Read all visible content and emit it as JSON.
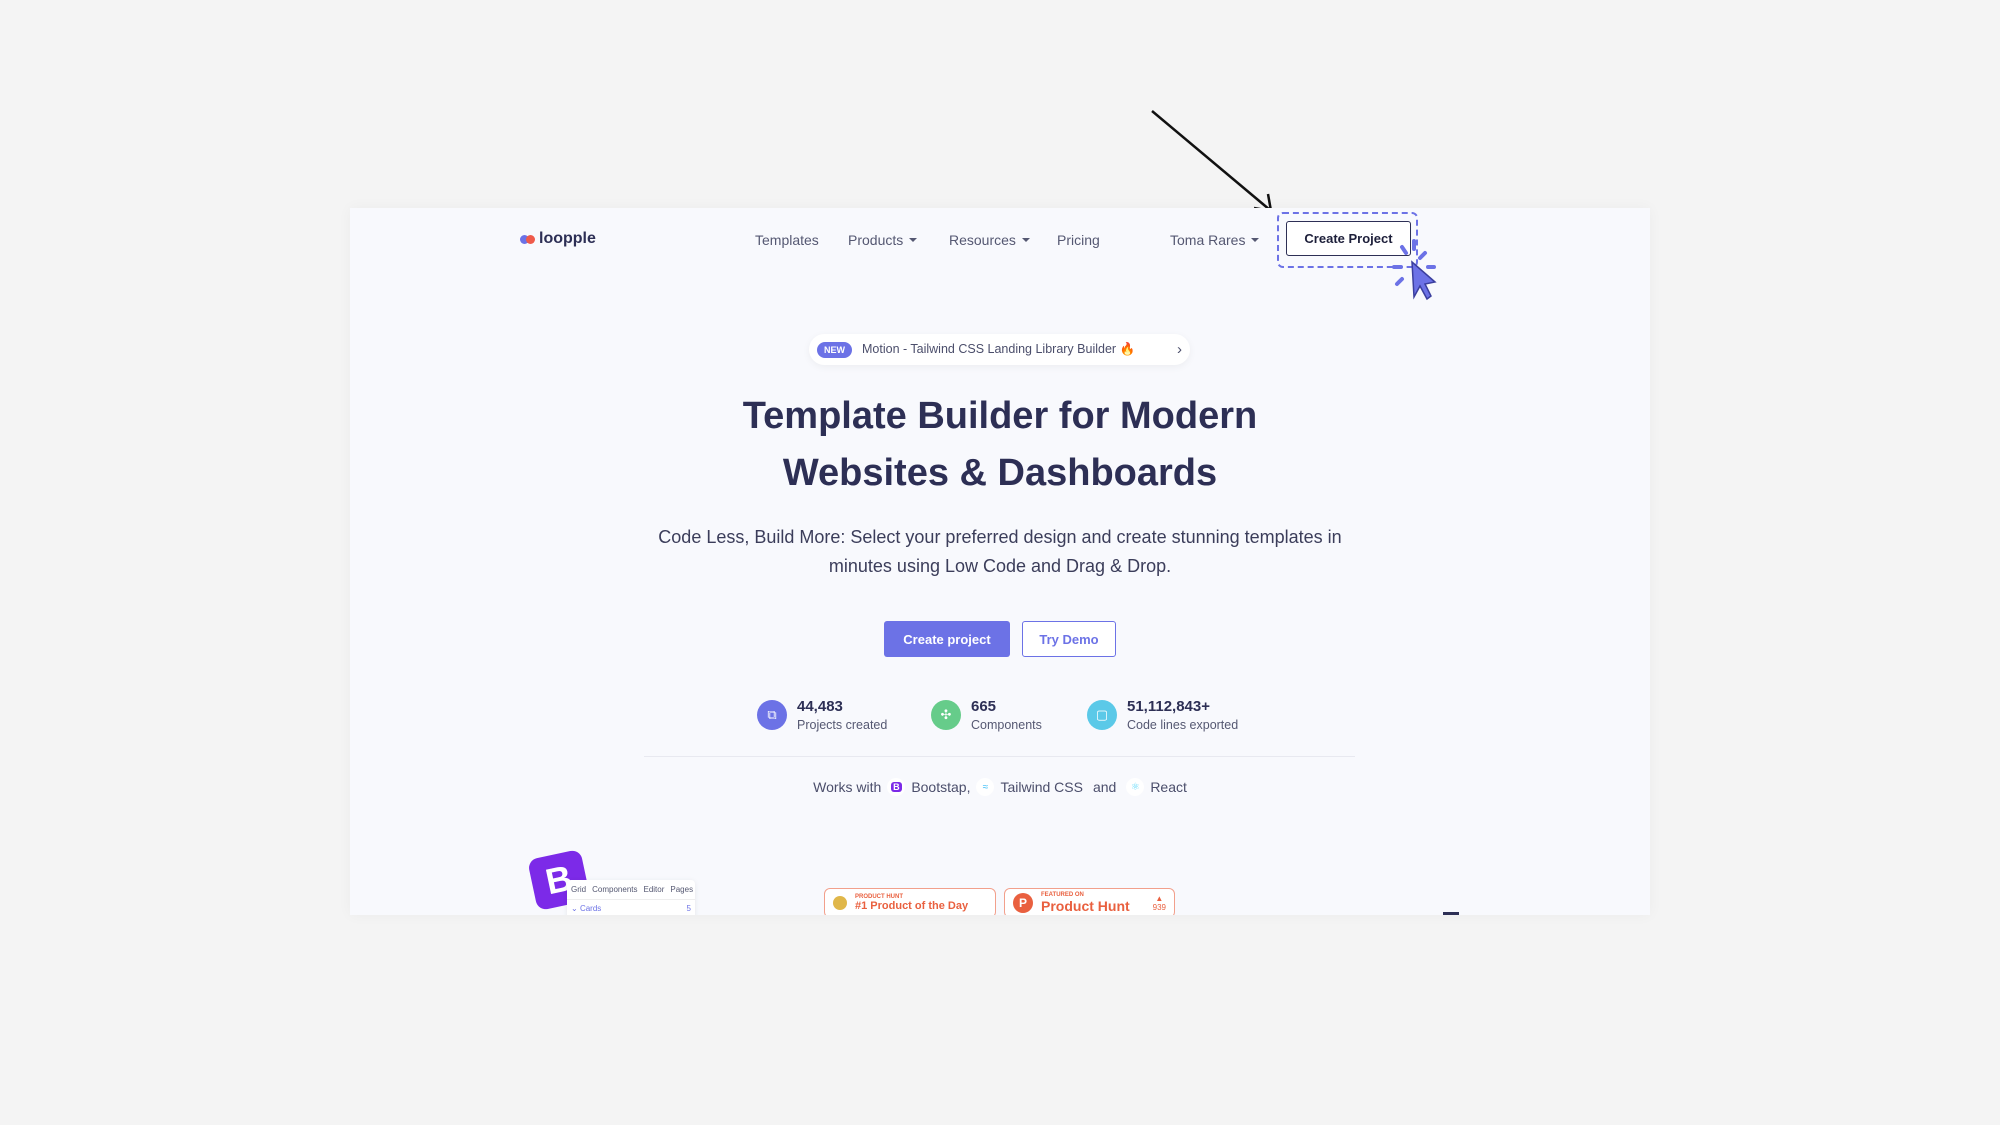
{
  "nav": {
    "logo": "loopple",
    "items": [
      "Templates",
      "Products",
      "Resources",
      "Pricing"
    ],
    "user": "Toma Rares",
    "create_project": "Create Project"
  },
  "announcement": {
    "badge": "NEW",
    "text": "Motion - Tailwind CSS Landing Library Builder 🔥"
  },
  "hero": {
    "title_line1": "Template Builder for Modern",
    "title_line2": "Websites & Dashboards",
    "subtitle": "Code Less, Build More: Select your preferred design and create stunning templates in minutes using Low Code and Drag & Drop.",
    "primary_button": "Create project",
    "secondary_button": "Try Demo"
  },
  "stats": [
    {
      "value": "44,483",
      "label": "Projects created",
      "color": "#6c72e6"
    },
    {
      "value": "665",
      "label": "Components",
      "color": "#66cc8a"
    },
    {
      "value": "51,112,843+",
      "label": "Code lines exported",
      "color": "#5bc9e8"
    }
  ],
  "works": {
    "prefix": "Works with",
    "bootstrap": "Bootstap,",
    "tailwind": "Tailwind CSS",
    "and": "and",
    "react": "React"
  },
  "preview": {
    "tabs": [
      "Grid",
      "Components",
      "Editor",
      "Pages"
    ],
    "row": "Cards",
    "count": "5"
  },
  "producthunt": {
    "b1_small": "PRODUCT HUNT",
    "b1_big": "#1 Product of the Day",
    "b2_small": "FEATURED ON",
    "b2_big": "Product Hunt",
    "votes": "939"
  },
  "colors": {
    "accent": "#6c72e6",
    "text": "#2d2f55",
    "background": "#f8f9fd"
  }
}
